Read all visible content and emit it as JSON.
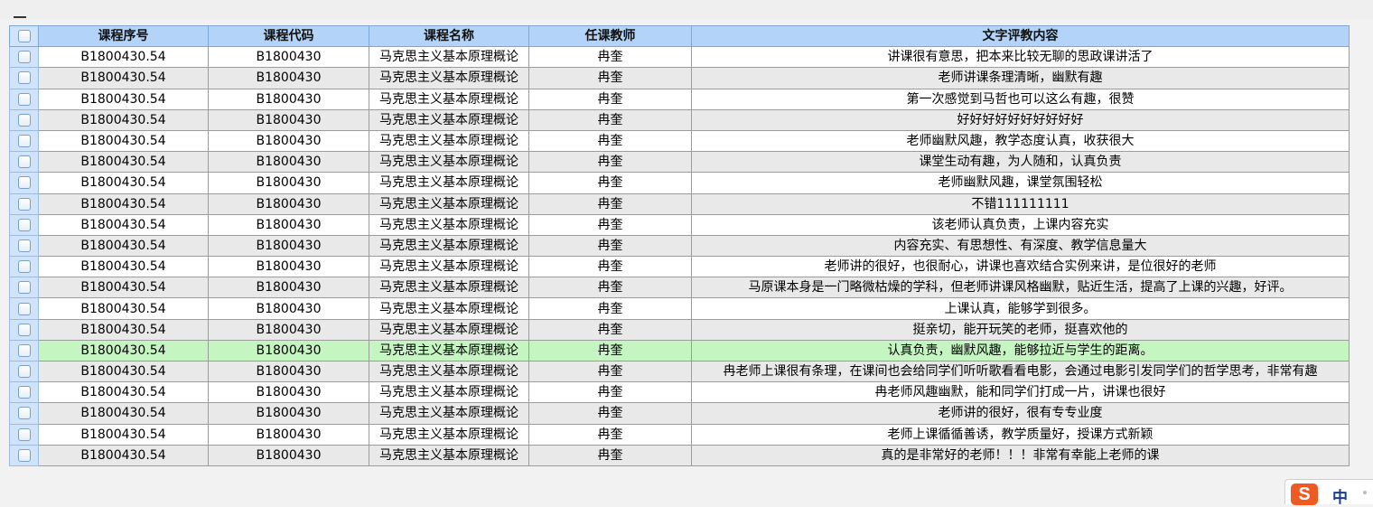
{
  "columns": {
    "seq": "课程序号",
    "code": "课程代码",
    "name": "课程名称",
    "teacher": "任课教师",
    "comment": "文字评教内容"
  },
  "rows": [
    {
      "seq": "B1800430.54",
      "code": "B1800430",
      "name": "马克思主义基本原理概论",
      "teacher": "冉奎",
      "comment": "讲课很有意思，把本来比较无聊的思政课讲活了"
    },
    {
      "seq": "B1800430.54",
      "code": "B1800430",
      "name": "马克思主义基本原理概论",
      "teacher": "冉奎",
      "comment": "老师讲课条理清晰，幽默有趣"
    },
    {
      "seq": "B1800430.54",
      "code": "B1800430",
      "name": "马克思主义基本原理概论",
      "teacher": "冉奎",
      "comment": "第一次感觉到马哲也可以这么有趣，很赞"
    },
    {
      "seq": "B1800430.54",
      "code": "B1800430",
      "name": "马克思主义基本原理概论",
      "teacher": "冉奎",
      "comment": "好好好好好好好好好好"
    },
    {
      "seq": "B1800430.54",
      "code": "B1800430",
      "name": "马克思主义基本原理概论",
      "teacher": "冉奎",
      "comment": "老师幽默风趣，教学态度认真，收获很大"
    },
    {
      "seq": "B1800430.54",
      "code": "B1800430",
      "name": "马克思主义基本原理概论",
      "teacher": "冉奎",
      "comment": "课堂生动有趣，为人随和，认真负责"
    },
    {
      "seq": "B1800430.54",
      "code": "B1800430",
      "name": "马克思主义基本原理概论",
      "teacher": "冉奎",
      "comment": "老师幽默风趣，课堂氛围轻松"
    },
    {
      "seq": "B1800430.54",
      "code": "B1800430",
      "name": "马克思主义基本原理概论",
      "teacher": "冉奎",
      "comment": "不错111111111"
    },
    {
      "seq": "B1800430.54",
      "code": "B1800430",
      "name": "马克思主义基本原理概论",
      "teacher": "冉奎",
      "comment": "该老师认真负责，上课内容充实"
    },
    {
      "seq": "B1800430.54",
      "code": "B1800430",
      "name": "马克思主义基本原理概论",
      "teacher": "冉奎",
      "comment": "内容充实、有思想性、有深度、教学信息量大"
    },
    {
      "seq": "B1800430.54",
      "code": "B1800430",
      "name": "马克思主义基本原理概论",
      "teacher": "冉奎",
      "comment": "老师讲的很好，也很耐心，讲课也喜欢结合实例来讲，是位很好的老师"
    },
    {
      "seq": "B1800430.54",
      "code": "B1800430",
      "name": "马克思主义基本原理概论",
      "teacher": "冉奎",
      "comment": "马原课本身是一门略微枯燥的学科，但老师讲课风格幽默，贴近生活，提高了上课的兴趣，好评。"
    },
    {
      "seq": "B1800430.54",
      "code": "B1800430",
      "name": "马克思主义基本原理概论",
      "teacher": "冉奎",
      "comment": "上课认真，能够学到很多。"
    },
    {
      "seq": "B1800430.54",
      "code": "B1800430",
      "name": "马克思主义基本原理概论",
      "teacher": "冉奎",
      "comment": "挺亲切，能开玩笑的老师，挺喜欢他的"
    },
    {
      "seq": "B1800430.54",
      "code": "B1800430",
      "name": "马克思主义基本原理概论",
      "teacher": "冉奎",
      "comment": "认真负责，幽默风趣，能够拉近与学生的距离。",
      "selected": true
    },
    {
      "seq": "B1800430.54",
      "code": "B1800430",
      "name": "马克思主义基本原理概论",
      "teacher": "冉奎",
      "comment": "冉老师上课很有条理，在课间也会给同学们听听歌看看电影，会通过电影引发同学们的哲学思考，非常有趣"
    },
    {
      "seq": "B1800430.54",
      "code": "B1800430",
      "name": "马克思主义基本原理概论",
      "teacher": "冉奎",
      "comment": "冉老师风趣幽默，能和同学们打成一片，讲课也很好"
    },
    {
      "seq": "B1800430.54",
      "code": "B1800430",
      "name": "马克思主义基本原理概论",
      "teacher": "冉奎",
      "comment": "老师讲的很好，很有专专业度"
    },
    {
      "seq": "B1800430.54",
      "code": "B1800430",
      "name": "马克思主义基本原理概论",
      "teacher": "冉奎",
      "comment": "老师上课循循善诱，教学质量好，授课方式新颖"
    },
    {
      "seq": "B1800430.54",
      "code": "B1800430",
      "name": "马克思主义基本原理概论",
      "teacher": "冉奎",
      "comment": "真的是非常好的老师！！！非常有幸能上老师的课"
    }
  ],
  "ime": {
    "logo": "S",
    "lang": "中"
  },
  "colors": {
    "header_bg": "#b3d4f8",
    "selected_row": "#c5f5c1",
    "ime_logo": "#ef5a23"
  }
}
